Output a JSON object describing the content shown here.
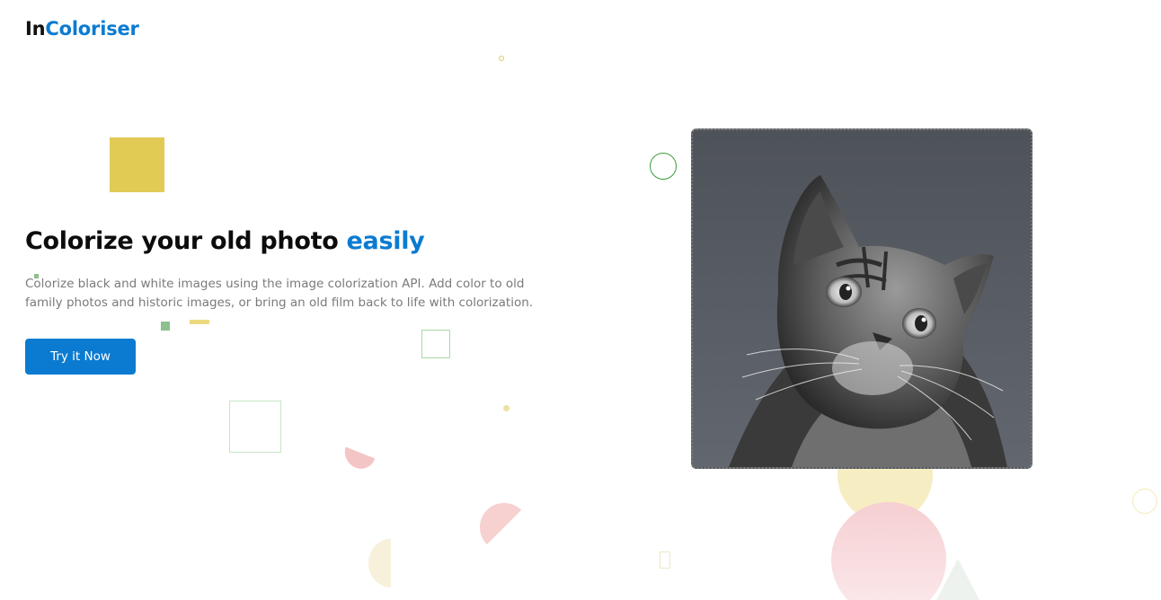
{
  "brand": {
    "prefix": "In",
    "accent": "Coloriser",
    "accent_color": "#0b7bd1"
  },
  "hero": {
    "title_main": "Colorize your old photo ",
    "title_accent": "easily",
    "description": "Colorize black and white images using the image colorization API. Add color to old family photos and historic images, or bring an old film back to life with colorization.",
    "cta_label": "Try it Now",
    "cta_color": "#0b7bd1"
  },
  "preview": {
    "image_icon": "cat-photo-icon"
  }
}
